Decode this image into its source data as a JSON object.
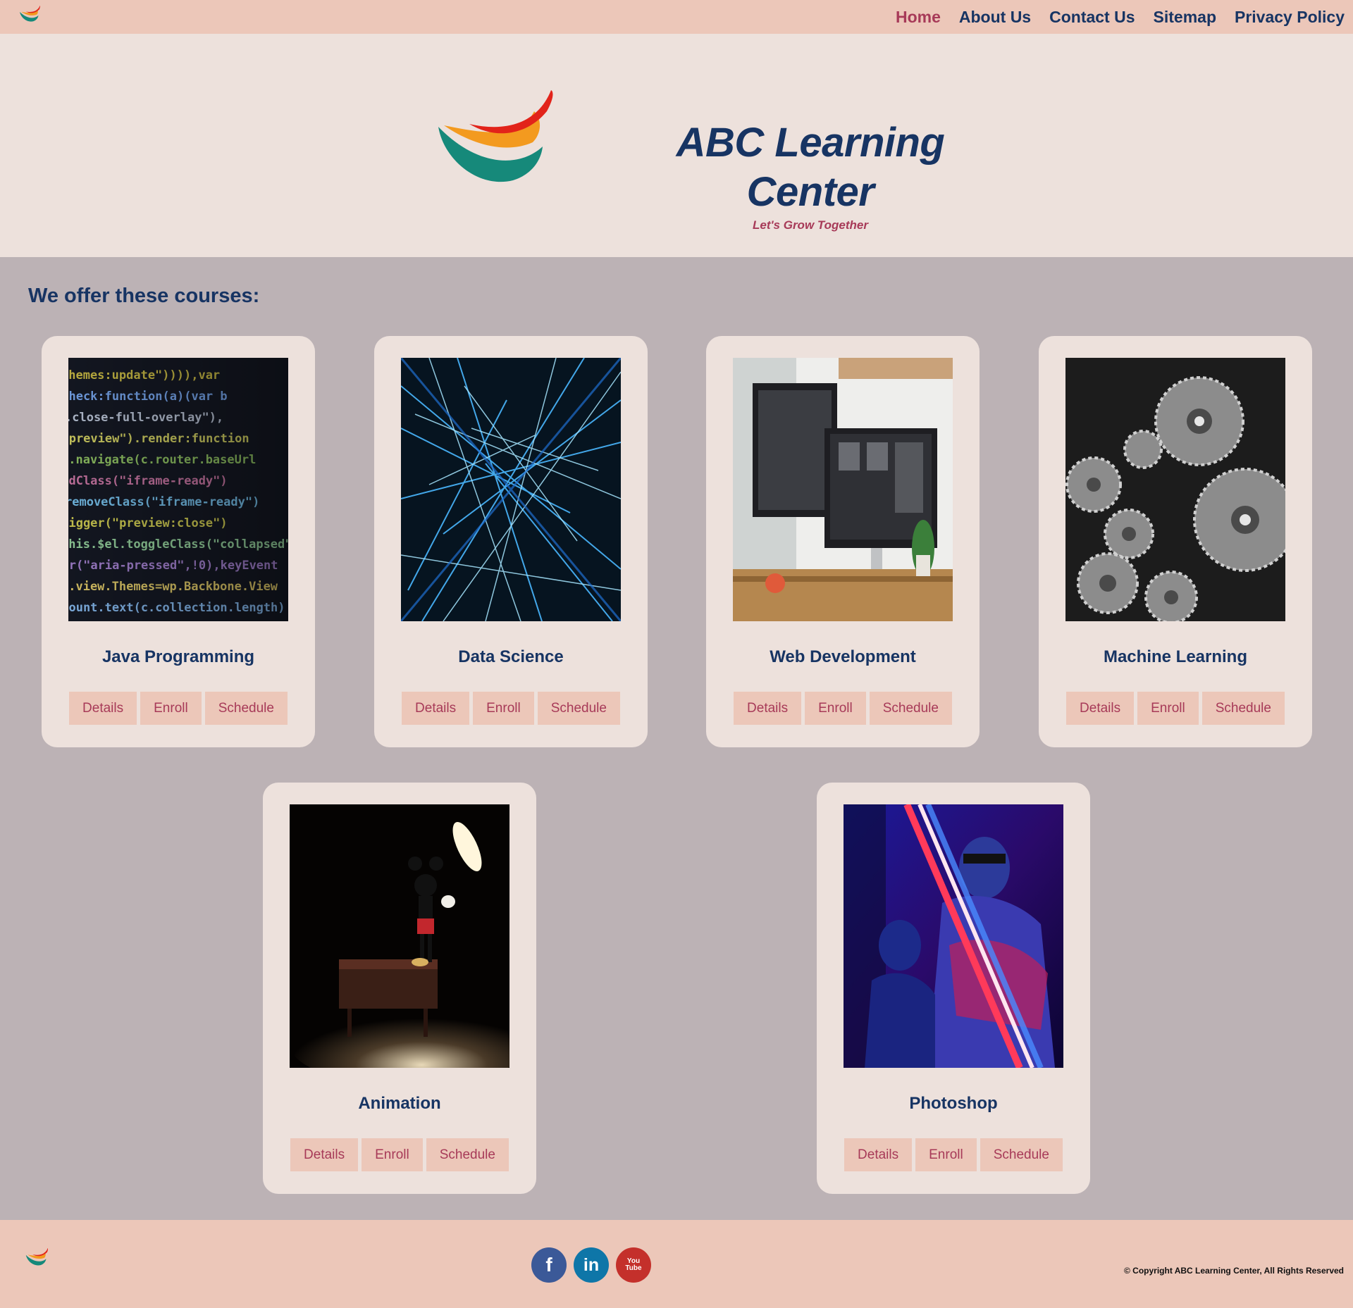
{
  "nav": {
    "items": [
      {
        "label": "Home",
        "active": true
      },
      {
        "label": "About Us"
      },
      {
        "label": "Contact Us"
      },
      {
        "label": "Sitemap"
      },
      {
        "label": "Privacy Policy"
      }
    ]
  },
  "hero": {
    "title": "ABC Learning Center",
    "tagline": "Let's Grow Together"
  },
  "courses": {
    "heading": "We offer these courses:",
    "items": [
      {
        "title": "Java Programming",
        "image": "code-screen-image"
      },
      {
        "title": "Data Science",
        "image": "network-lines-image"
      },
      {
        "title": "Web Development",
        "image": "desk-monitors-image"
      },
      {
        "title": "Machine Learning",
        "image": "gears-image"
      },
      {
        "title": "Animation",
        "image": "mickey-piano-image"
      },
      {
        "title": "Photoshop",
        "image": "neon-lights-image"
      }
    ],
    "buttons": {
      "details": "Details",
      "enroll": "Enroll",
      "schedule": "Schedule"
    }
  },
  "footer": {
    "social": [
      {
        "name": "facebook-icon",
        "glyph": "f",
        "color": "#3b5998"
      },
      {
        "name": "linkedin-icon",
        "glyph": "in",
        "color": "#0e76a8"
      },
      {
        "name": "youtube-icon",
        "glyph": "You Tube",
        "color": "#c4302b"
      }
    ],
    "copyright": "© Copyright ABC Learning Center, All Rights Reserved"
  },
  "colors": {
    "nav_bg": "#ecc7b9",
    "hero_bg": "#ede1dc",
    "section_bg": "#bcb2b5",
    "navy": "#173463",
    "accent": "#a73a58"
  }
}
